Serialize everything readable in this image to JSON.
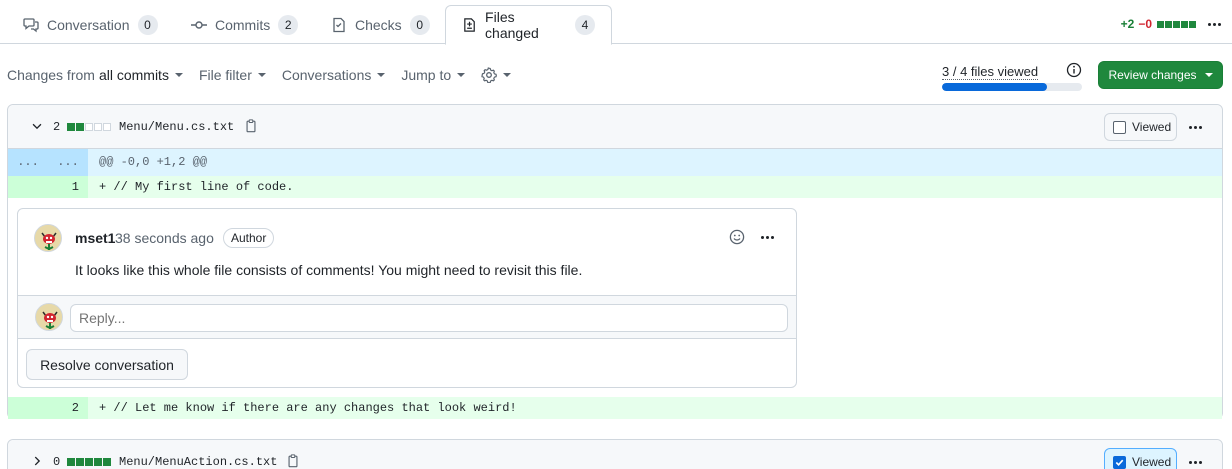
{
  "tabs": [
    {
      "label": "Conversation",
      "count": "0",
      "icon": "comment-discussion-icon"
    },
    {
      "label": "Commits",
      "count": "2",
      "icon": "git-commit-icon"
    },
    {
      "label": "Checks",
      "count": "0",
      "icon": "checklist-icon"
    },
    {
      "label": "Files changed",
      "count": "4",
      "icon": "file-diff-icon",
      "active": true
    }
  ],
  "diffstat": {
    "additions": "+2",
    "deletions": "−0"
  },
  "toolbar": {
    "changes_from_prefix": "Changes from",
    "changes_from_value": "all commits",
    "file_filter": "File filter",
    "conversations": "Conversations",
    "jump_to": "Jump to",
    "settings_icon": "gear-icon"
  },
  "viewed_progress": {
    "label": "3 / 4 files viewed",
    "viewed": 3,
    "total": 4
  },
  "review_button": "Review changes",
  "files": [
    {
      "changes": "2",
      "name": "Menu/Menu.cs.txt",
      "viewed_label": "Viewed",
      "viewed": false,
      "hunk": {
        "old": "...",
        "new": "...",
        "header": "@@ -0,0 +1,2 @@"
      },
      "lines": [
        {
          "number": "1",
          "code": "+ // My first line of code."
        },
        {
          "number": "2",
          "code": "+ // Let me know if there are any changes that look weird!"
        }
      ],
      "comment": {
        "author": "mset1",
        "time": "38 seconds ago",
        "badge": "Author",
        "body": "It looks like this whole file consists of comments! You might need to revisit this file.",
        "reply_placeholder": "Reply...",
        "resolve_label": "Resolve conversation"
      }
    },
    {
      "changes": "0",
      "name": "Menu/MenuAction.cs.txt",
      "viewed_label": "Viewed",
      "viewed": true
    }
  ],
  "colors": {
    "accent": "#0969da",
    "success": "#1f883d",
    "danger": "#d1242f"
  }
}
